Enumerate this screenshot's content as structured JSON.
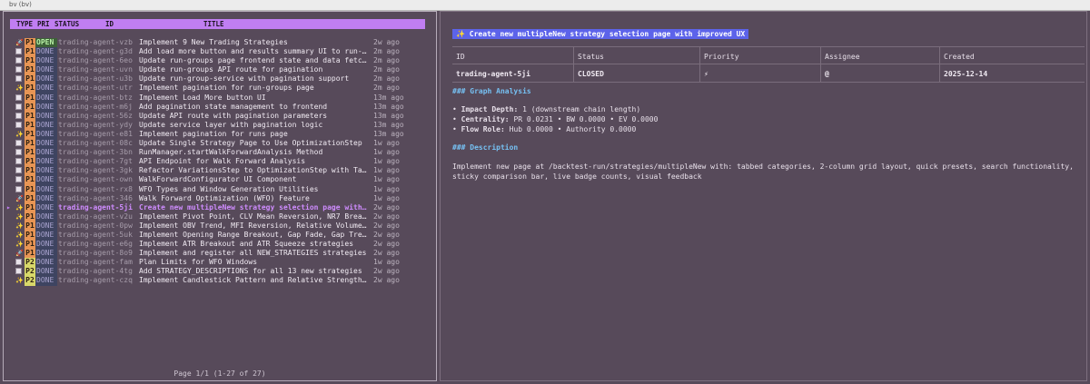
{
  "window": {
    "title": "bv (bv)"
  },
  "list": {
    "headers": {
      "type": "TYPE",
      "pri": "PRI",
      "status": "STATUS",
      "id": "ID",
      "title": "TITLE"
    },
    "rows": [
      {
        "icon": "rocket",
        "pri": "P1",
        "status": "OPEN",
        "id": "trading-agent-vzb",
        "title": "Implement 9 New Trading Strategies",
        "age": "2w ago"
      },
      {
        "icon": "check",
        "pri": "P1",
        "status": "DONE",
        "id": "trading-agent-g3d",
        "title": "Add load more button and results summary UI to run-…",
        "age": "2m ago"
      },
      {
        "icon": "check",
        "pri": "P1",
        "status": "DONE",
        "id": "trading-agent-6eo",
        "title": "Update run-groups page frontend state and data fetc…",
        "age": "2m ago"
      },
      {
        "icon": "check",
        "pri": "P1",
        "status": "DONE",
        "id": "trading-agent-uvn",
        "title": "Update run-groups API route for pagination",
        "age": "2m ago"
      },
      {
        "icon": "check",
        "pri": "P1",
        "status": "DONE",
        "id": "trading-agent-u3b",
        "title": "Update run-group-service with pagination support",
        "age": "2m ago"
      },
      {
        "icon": "sparkle",
        "pri": "P1",
        "status": "DONE",
        "id": "trading-agent-utr",
        "title": "Implement pagination for run-groups page",
        "age": "2m ago"
      },
      {
        "icon": "check",
        "pri": "P1",
        "status": "DONE",
        "id": "trading-agent-btz",
        "title": "Implement Load More button UI",
        "age": "13m ago"
      },
      {
        "icon": "check",
        "pri": "P1",
        "status": "DONE",
        "id": "trading-agent-m6j",
        "title": "Add pagination state management to frontend",
        "age": "13m ago"
      },
      {
        "icon": "check",
        "pri": "P1",
        "status": "DONE",
        "id": "trading-agent-56z",
        "title": "Update API route with pagination parameters",
        "age": "13m ago"
      },
      {
        "icon": "check",
        "pri": "P1",
        "status": "DONE",
        "id": "trading-agent-ydy",
        "title": "Update service layer with pagination logic",
        "age": "13m ago"
      },
      {
        "icon": "sparkle",
        "pri": "P1",
        "status": "DONE",
        "id": "trading-agent-e81",
        "title": "Implement pagination for runs page",
        "age": "13m ago"
      },
      {
        "icon": "check",
        "pri": "P1",
        "status": "DONE",
        "id": "trading-agent-08c",
        "title": "Update Single Strategy Page to Use OptimizationStep",
        "age": "1w ago"
      },
      {
        "icon": "check",
        "pri": "P1",
        "status": "DONE",
        "id": "trading-agent-3bn",
        "title": "RunManager.startWalkForwardAnalysis Method",
        "age": "1w ago"
      },
      {
        "icon": "check",
        "pri": "P1",
        "status": "DONE",
        "id": "trading-agent-7gt",
        "title": "API Endpoint for Walk Forward Analysis",
        "age": "1w ago"
      },
      {
        "icon": "check",
        "pri": "P1",
        "status": "DONE",
        "id": "trading-agent-3gk",
        "title": "Refactor VariationsStep to OptimizationStep with Ta…",
        "age": "1w ago"
      },
      {
        "icon": "check",
        "pri": "P1",
        "status": "DONE",
        "id": "trading-agent-own",
        "title": "WalkForwardConfigurator UI Component",
        "age": "1w ago"
      },
      {
        "icon": "check",
        "pri": "P1",
        "status": "DONE",
        "id": "trading-agent-rx8",
        "title": "WFO Types and Window Generation Utilities",
        "age": "1w ago"
      },
      {
        "icon": "rocket",
        "pri": "P1",
        "status": "DONE",
        "id": "trading-agent-346",
        "title": "Walk Forward Optimization (WFO) Feature",
        "age": "1w ago"
      },
      {
        "icon": "sparkle",
        "pri": "P1",
        "status": "DONE",
        "id": "trading-agent-5ji",
        "title": "Create new multipleNew strategy selection page with…",
        "age": "2w ago",
        "selected": true
      },
      {
        "icon": "sparkle",
        "pri": "P1",
        "status": "DONE",
        "id": "trading-agent-v2u",
        "title": "Implement Pivot Point, CLV Mean Reversion, NR7 Brea…",
        "age": "2w ago"
      },
      {
        "icon": "sparkle",
        "pri": "P1",
        "status": "DONE",
        "id": "trading-agent-0pw",
        "title": "Implement OBV Trend, MFI Reversion, Relative Volume…",
        "age": "2w ago"
      },
      {
        "icon": "sparkle",
        "pri": "P1",
        "status": "DONE",
        "id": "trading-agent-5uk",
        "title": "Implement Opening Range Breakout, Gap Fade, Gap Tre…",
        "age": "2w ago"
      },
      {
        "icon": "sparkle",
        "pri": "P1",
        "status": "DONE",
        "id": "trading-agent-e6g",
        "title": "Implement ATR Breakout and ATR Squeeze strategies",
        "age": "2w ago"
      },
      {
        "icon": "rocket",
        "pri": "P1",
        "status": "DONE",
        "id": "trading-agent-8o9",
        "title": "Implement and register all NEW_STRATEGIES strategies",
        "age": "2w ago"
      },
      {
        "icon": "check",
        "pri": "P2",
        "status": "DONE",
        "id": "trading-agent-fam",
        "title": "Plan Limits for WFO Windows",
        "age": "1w ago"
      },
      {
        "icon": "check",
        "pri": "P2",
        "status": "DONE",
        "id": "trading-agent-4tg",
        "title": "Add STRATEGY_DESCRIPTIONS for all 13 new strategies",
        "age": "2w ago"
      },
      {
        "icon": "sparkle",
        "pri": "P2",
        "status": "DONE",
        "id": "trading-agent-czq",
        "title": "Implement Candlestick Pattern and Relative Strength…",
        "age": "2w ago"
      }
    ],
    "footer": "Page 1/1 (1-27 of 27)"
  },
  "detail": {
    "title": "✨ Create new multipleNew strategy selection page with improved UX",
    "table": {
      "headers": {
        "id": "ID",
        "status": "Status",
        "priority": "Priority",
        "assignee": "Assignee",
        "created": "Created"
      },
      "values": {
        "id": "trading-agent-5ji",
        "status": "CLOSED",
        "priority": "⚡",
        "assignee": "@",
        "created": "2025-12-14"
      }
    },
    "graph_heading": "### Graph Analysis",
    "metrics": [
      {
        "label": "Impact Depth:",
        "value": "1 (downstream chain length)"
      },
      {
        "label": "Centrality:",
        "value": "PR 0.0231 • BW 0.0000 • EV 0.0000"
      },
      {
        "label": "Flow Role:",
        "value": "Hub 0.0000 • Authority 0.0000"
      }
    ],
    "description_heading": "### Description",
    "description": "Implement new page at /backtest-run/strategies/multipleNew with: tabbed categories, 2-column grid layout, quick presets, search functionality, sticky comparison bar, live badge counts, visual feedback"
  }
}
